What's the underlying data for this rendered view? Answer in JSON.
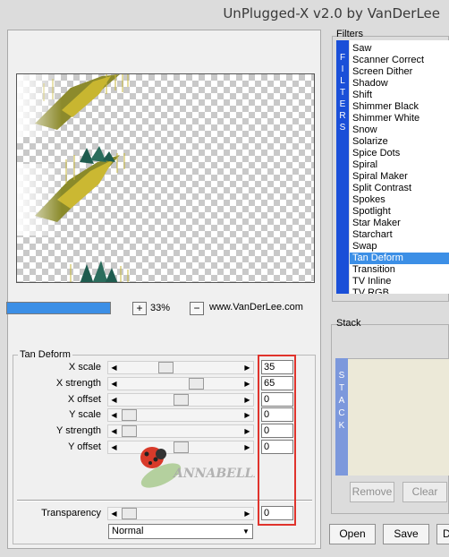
{
  "window": {
    "title": "UnPlugged-X v2.0 by VanDerLee"
  },
  "zoom": {
    "minus": "−",
    "plus": "+",
    "value": "33%",
    "progress": 1.0
  },
  "website": "www.VanDerLee.com",
  "filter_panel": {
    "title": "Tan Deform",
    "sliders": [
      {
        "label": "X scale",
        "value": "35"
      },
      {
        "label": "X strength",
        "value": "65"
      },
      {
        "label": "X offset",
        "value": "0"
      },
      {
        "label": "Y scale",
        "value": "0"
      },
      {
        "label": "Y strength",
        "value": "0"
      },
      {
        "label": "Y offset",
        "value": "0"
      }
    ],
    "transparency": {
      "label": "Transparency",
      "value": "0"
    },
    "blend_mode": "Normal"
  },
  "watermark_text": "ANNABELLE",
  "filters": {
    "title": "Filters",
    "strip_letters": [
      "F",
      "I",
      "L",
      "T",
      "E",
      "R",
      "S"
    ],
    "items": [
      "Saw",
      "Scanner Correct",
      "Screen Dither",
      "Shadow",
      "Shift",
      "Shimmer Black",
      "Shimmer White",
      "Snow",
      "Solarize",
      "Spice Dots",
      "Spiral",
      "Spiral Maker",
      "Split Contrast",
      "Spokes",
      "Spotlight",
      "Star Maker",
      "Starchart",
      "Swap",
      "Tan Deform",
      "Transition",
      "TV Inline",
      "TV RGB"
    ],
    "selected": "Tan Deform"
  },
  "stack": {
    "title": "Stack",
    "strip_letters": [
      "S",
      "T",
      "A",
      "C",
      "K"
    ],
    "remove_label": "Remove",
    "clear_label": "Clear"
  },
  "buttons": {
    "open": "Open",
    "save": "Save",
    "partial": "D"
  },
  "colors": {
    "selection": "#3c8fe6",
    "filters_strip": "#1a4fd8",
    "stack_strip": "#7c98dc",
    "highlight_box": "#e0332c"
  }
}
